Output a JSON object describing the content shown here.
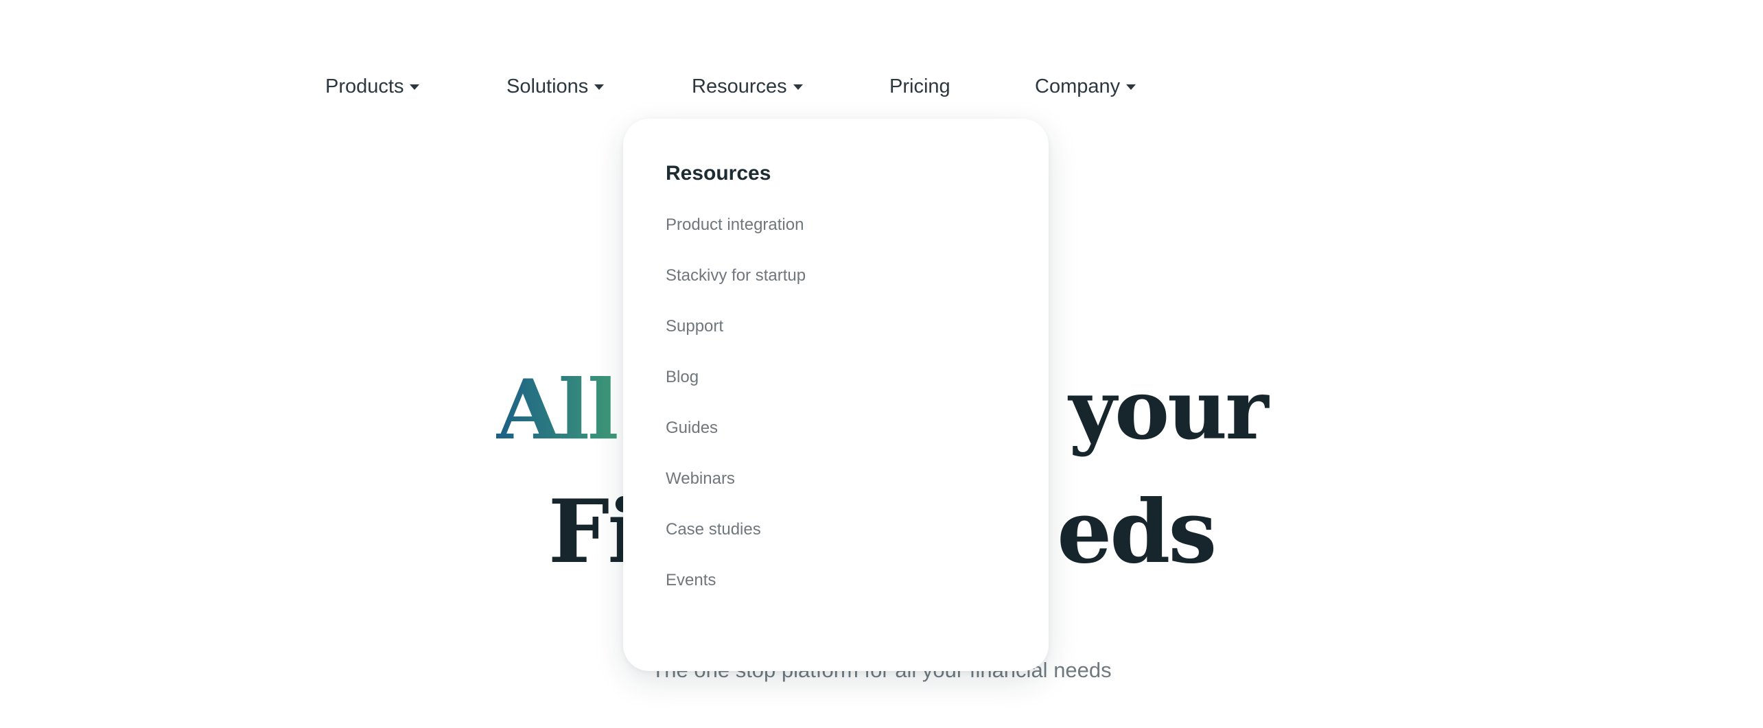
{
  "nav": {
    "items": [
      {
        "label": "Products",
        "has_dropdown": true
      },
      {
        "label": "Solutions",
        "has_dropdown": true
      },
      {
        "label": "Resources",
        "has_dropdown": true
      },
      {
        "label": "Pricing",
        "has_dropdown": false
      },
      {
        "label": "Company",
        "has_dropdown": true
      }
    ]
  },
  "dropdown": {
    "title": "Resources",
    "items": [
      {
        "label": "Product integration"
      },
      {
        "label": "Stackivy for startup"
      },
      {
        "label": "Support"
      },
      {
        "label": "Blog"
      },
      {
        "label": "Guides"
      },
      {
        "label": "Webinars"
      },
      {
        "label": "Case studies"
      },
      {
        "label": "Events"
      }
    ]
  },
  "hero": {
    "line1_accent": "All",
    "line1_rest": " your",
    "line2_visible_start": "Fi",
    "line2_visible_end": "eds",
    "subtitle_visible_start": "The one stop platform for all your financial",
    "subtitle_visible_end": " needs"
  },
  "colors": {
    "text": "#23303a",
    "hero": "#16262c",
    "accent_start": "#1b5f86",
    "accent_end": "#3f9a78",
    "muted": "#6f777c"
  }
}
